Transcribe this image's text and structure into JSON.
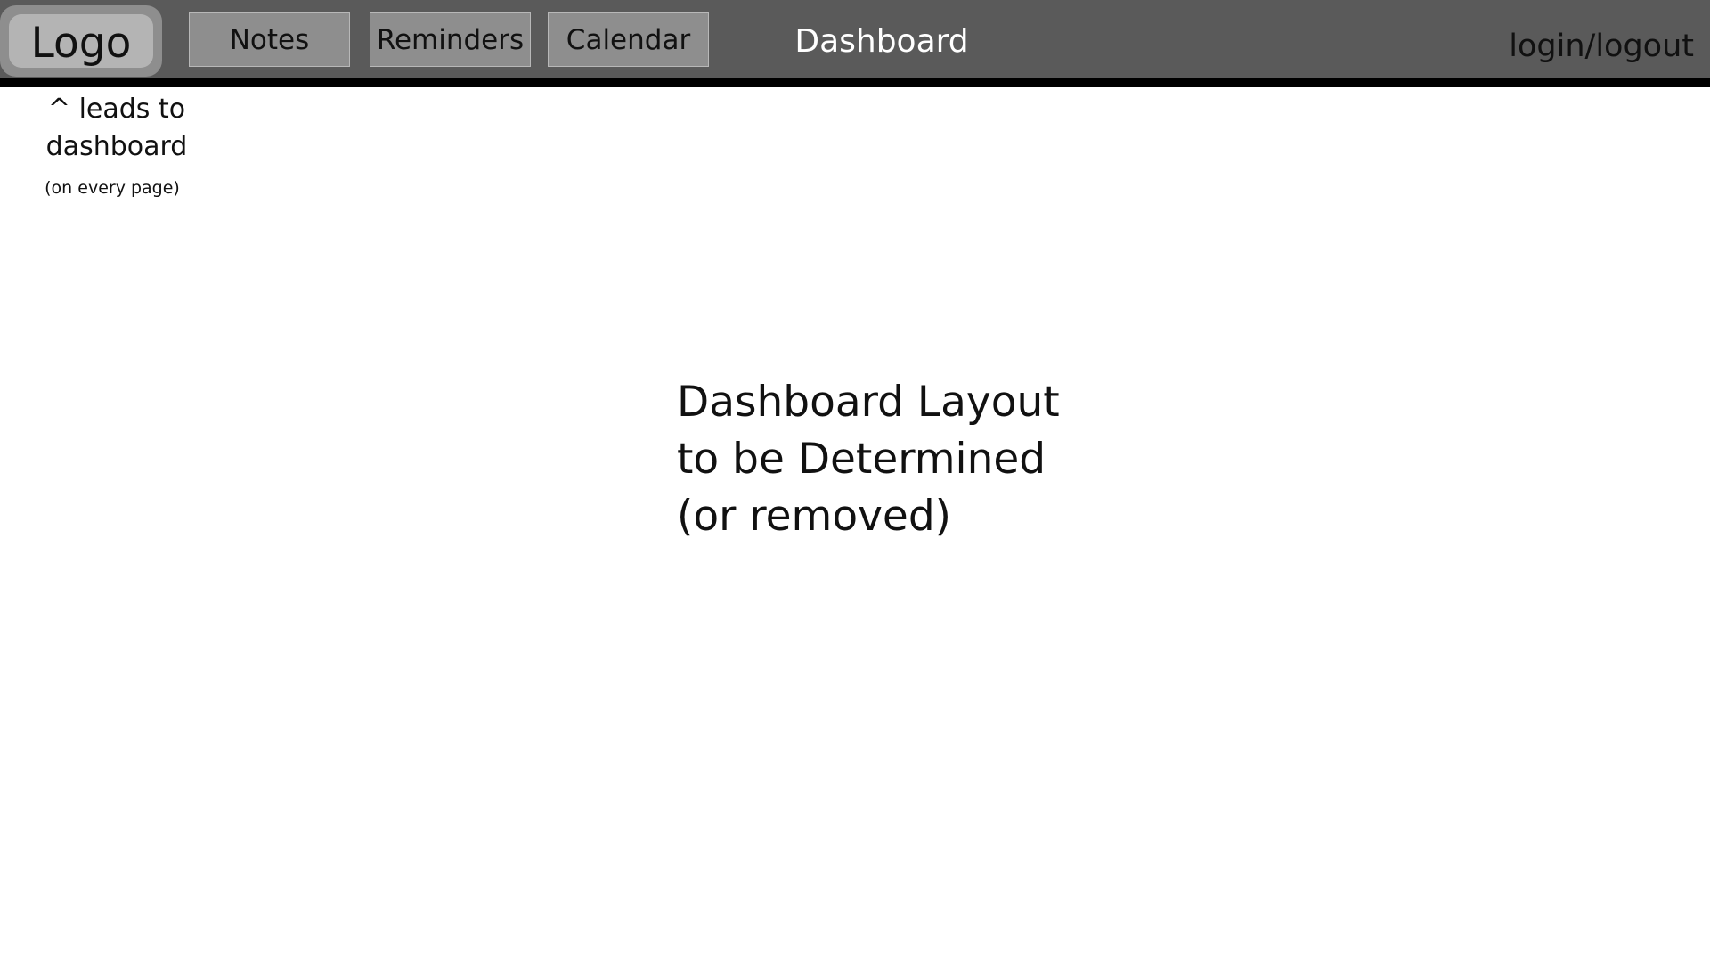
{
  "header": {
    "logo_label": "Logo",
    "nav": {
      "notes": "Notes",
      "reminders": "Reminders",
      "calendar": "Calendar"
    },
    "title": "Dashboard",
    "auth_link": "login/logout"
  },
  "annotation": {
    "line1": "^ leads to",
    "line2": "dashboard",
    "small": "(on every page)"
  },
  "main": {
    "placeholder_lines": [
      "Dashboard Layout",
      "to be Determined",
      "(or removed)"
    ]
  },
  "colors": {
    "header_bg": "#5a5a5a",
    "header_rule": "#000000",
    "button_bg": "#8e8e8e",
    "logo_inner_bg": "#b4b4b4",
    "page_bg": "#ffffff"
  }
}
